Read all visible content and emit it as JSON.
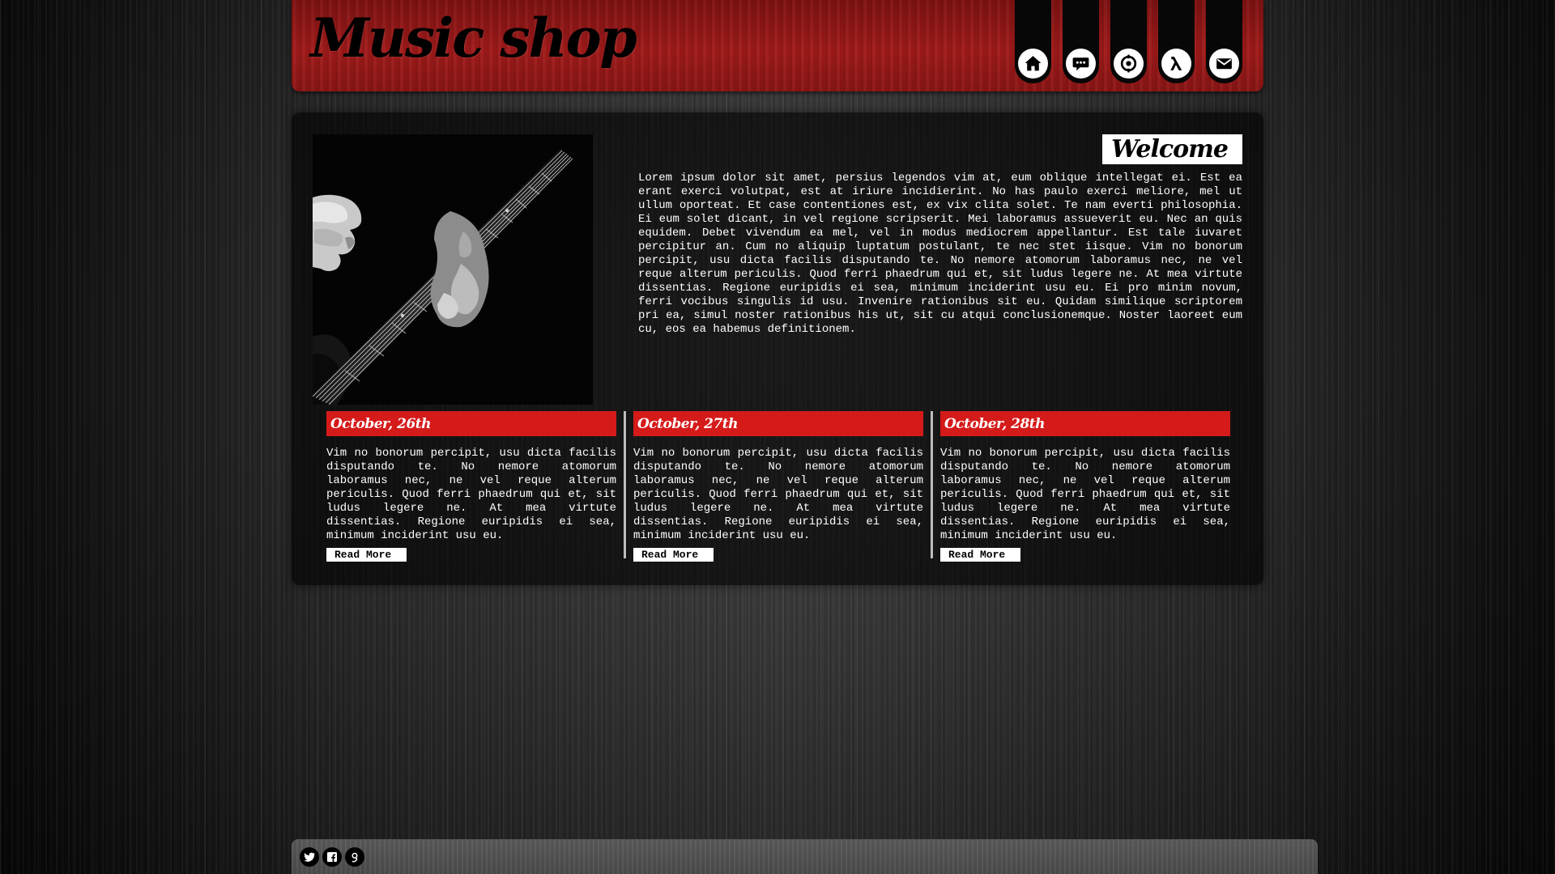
{
  "header": {
    "logo_text": "Music shop"
  },
  "nav": {
    "items": [
      {
        "icon": "home-icon"
      },
      {
        "icon": "chat-icon"
      },
      {
        "icon": "target-icon"
      },
      {
        "icon": "lambda-icon"
      },
      {
        "icon": "mail-icon"
      }
    ]
  },
  "welcome": {
    "heading": "Welcome",
    "text": "Lorem ipsum dolor sit amet, persius legendos vim at, eum oblique intellegat ei. Est ea erant exerci volutpat, est at iriure incidierint. No has paulo exerci meliore, mel ut ullum oporteat. Et case contentiones est, ex vix clita solet. Te nam everti philosophia. Ei eum solet dicant, in vel regione scripserit. Mei laboramus assueverit eu. Nec an quis equidem. Debet vivendum ea mel, vel in modus mediocrem appellantur. Est tale iuvaret percipitur an. Cum no aliquip luptatum postulant, te nec stet iisque. Vim no bonorum percipit, usu dicta facilis disputando te. No nemore atomorum laboramus nec, ne vel reque alterum periculis. Quod ferri phaedrum qui et, sit ludus legere ne. At mea virtute dissentias. Regione euripidis ei sea, minimum inciderint usu eu. Ei pro minim novum, ferri vocibus singulis id usu. Invenire rationibus sit eu. Quidam similique scriptorem pri ea, simul noster rationibus his ut, sit cu atqui conclusionemque. Noster laoreet eum cu, eos ea habemus definitionem."
  },
  "news": [
    {
      "date": "October, 26th",
      "text": "Vim no bonorum percipit, usu dicta facilis disputando te. No nemore atomorum laboramus nec, ne vel reque alterum periculis. Quod ferri phaedrum qui et, sit ludus legere ne. At mea virtute dissentias. Regione euripidis ei sea, minimum inciderint usu eu.",
      "read_more": "Read More"
    },
    {
      "date": "October, 27th",
      "text": "Vim no bonorum percipit, usu dicta facilis disputando te. No nemore atomorum laboramus nec, ne vel reque alterum periculis. Quod ferri phaedrum qui et, sit ludus legere ne. At mea virtute dissentias. Regione euripidis ei sea, minimum inciderint usu eu.",
      "read_more": "Read More"
    },
    {
      "date": "October, 28th",
      "text": "Vim no bonorum percipit, usu dicta facilis disputando te. No nemore atomorum laboramus nec, ne vel reque alterum periculis. Quod ferri phaedrum qui et, sit ludus legere ne. At mea virtute dissentias. Regione euripidis ei sea, minimum inciderint usu eu.",
      "read_more": "Read More"
    }
  ],
  "footer": {
    "social": [
      {
        "icon": "twitter-icon"
      },
      {
        "icon": "facebook-icon"
      },
      {
        "icon": "google-plus-icon"
      }
    ]
  },
  "colors": {
    "accent_red": "#d51a1a",
    "header_red": "#a11a1a",
    "text": "#ffffff"
  }
}
